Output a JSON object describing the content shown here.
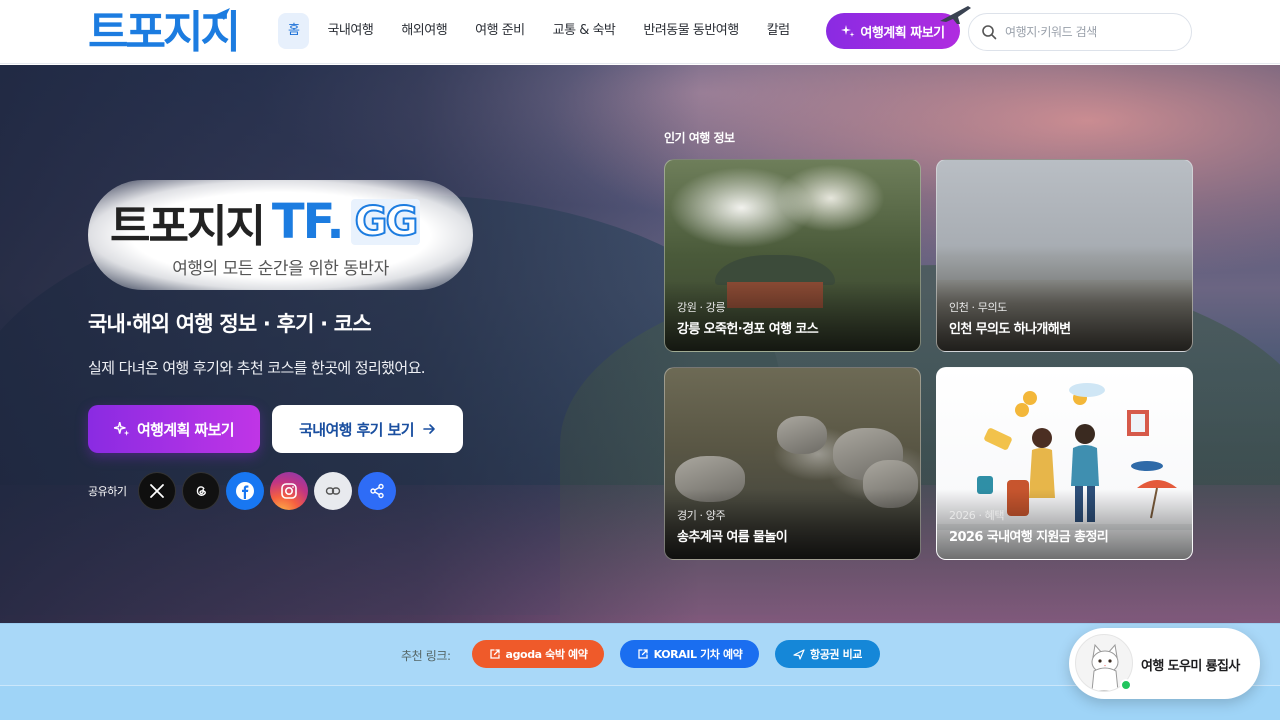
{
  "header": {
    "logo_text": "트포지지",
    "nav": [
      {
        "label": "홈",
        "active": true
      },
      {
        "label": "국내여행"
      },
      {
        "label": "해외여행"
      },
      {
        "label": "여행 준비"
      },
      {
        "label": "교통 & 숙박"
      },
      {
        "label": "반려동물 동반여행"
      },
      {
        "label": "칼럼"
      }
    ],
    "plan_button": "여행계획 짜보기",
    "search_placeholder": "여행지·키워드 검색"
  },
  "hero": {
    "badge_title": "트포지지",
    "badge_tf": "TF.",
    "badge_gg": "GG",
    "badge_subtitle": "여행의 모든 순간을 위한 동반자",
    "title": "국내·해외 여행 정보 · 후기 · 코스",
    "description": "실제 다녀온 여행 후기와 추천 코스를 한곳에 정리했어요.",
    "cta_primary": "여행계획 짜보기",
    "cta_secondary": "국내여행 후기 보기",
    "share_label": "공유하기",
    "share_icons": [
      "x-icon",
      "threads-icon",
      "facebook-icon",
      "instagram-icon",
      "link-icon",
      "share-icon"
    ]
  },
  "popular": {
    "label": "인기 여행 정보",
    "cards": [
      {
        "region": "강원 · 강릉",
        "title": "강릉 오죽헌·경포 여행 코스"
      },
      {
        "region": "인천 · 무의도",
        "title": "인천 무의도 하나개해변"
      },
      {
        "region": "경기 · 양주",
        "title": "송추계곡 여름 물놀이"
      },
      {
        "region": "2026 · 혜택",
        "title": "2026 국내여행 지원금 총정리"
      }
    ]
  },
  "recommend": {
    "label": "추천 링크:",
    "links": [
      {
        "label": "agoda 숙박 예약",
        "color": "#ef5a2a"
      },
      {
        "label": "KORAIL 기차 예약",
        "color": "#1a6ef0"
      },
      {
        "label": "항공권 비교",
        "color": "#1587d8"
      }
    ]
  },
  "helper": {
    "label": "여행 도우미 룡집사",
    "status": "online"
  },
  "colors": {
    "brand": "#1c7ce0",
    "accent_purple": "#8a2be2"
  }
}
